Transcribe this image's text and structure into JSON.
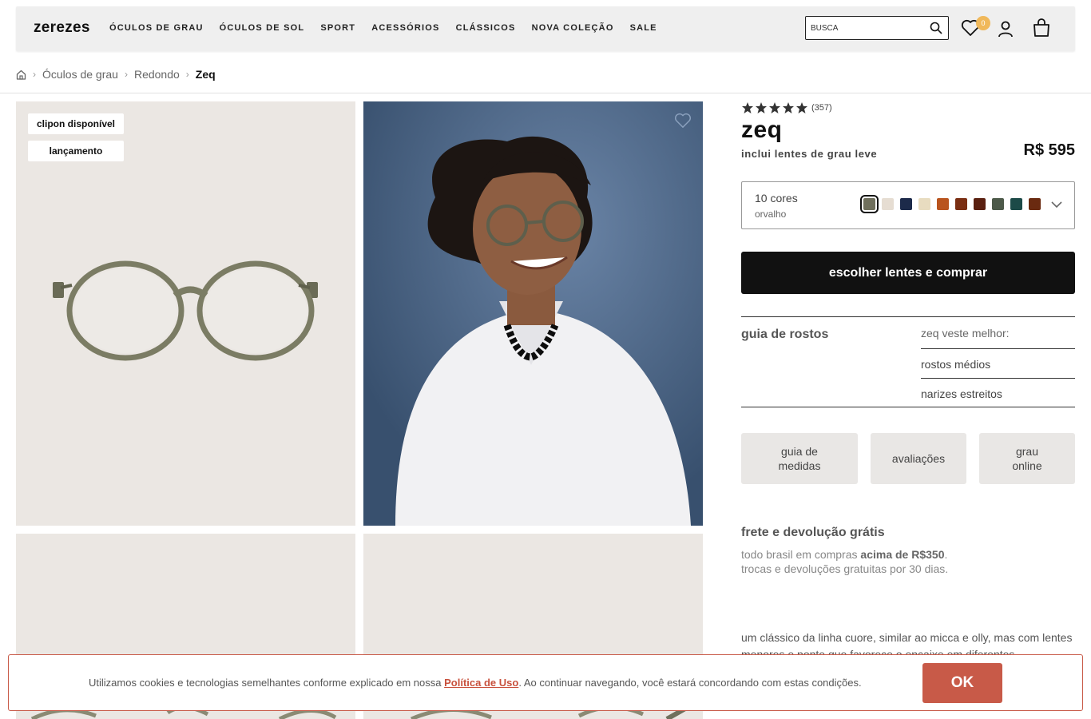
{
  "header": {
    "logo": "zerezes",
    "nav": [
      "ÓCULOS DE GRAU",
      "ÓCULOS DE SOL",
      "SPORT",
      "ACESSÓRIOS",
      "CLÁSSICOS",
      "NOVA COLEÇÃO",
      "SALE"
    ],
    "search_placeholder": "BUSCA",
    "wishlist_count": "0"
  },
  "breadcrumb": {
    "items": [
      "Óculos de grau",
      "Redondo"
    ],
    "current": "Zeq"
  },
  "gallery": {
    "tags": [
      "clipon disponível",
      "lançamento"
    ]
  },
  "product": {
    "rating_stars": 5,
    "rating_count": "(357)",
    "name": "zeq",
    "subtitle": "inclui lentes de grau leve",
    "price": "R$ 595",
    "colors_count": "10 cores",
    "selected_color": "orvalho",
    "swatches": [
      "#6f6f5c",
      "#e6ddd2",
      "#1c2a4a",
      "#e8dcc0",
      "#b9541e",
      "#7a2e12",
      "#5a2010",
      "#4d5a4a",
      "#1c4a48",
      "#6a2a10"
    ],
    "buy_label": "escolher lentes e comprar",
    "faces_title": "guia de rostos",
    "faces_head": "zeq veste melhor:",
    "faces_items": [
      "rostos médios",
      "narizes estreitos"
    ],
    "buttons": {
      "measures": "guia de medidas",
      "reviews": "avaliações",
      "online": "grau online"
    },
    "shipping_title": "frete e devolução grátis",
    "shipping_line1_prefix": "todo brasil em compras ",
    "shipping_line1_bold": "acima de R$350",
    "shipping_line1_suffix": ".",
    "shipping_line2": "trocas e devoluções gratuitas por 30 dias.",
    "description": "um clássico da linha cuore, similar ao micca e olly, mas com lentes menores e ponte que favorece o encaixe em diferentes"
  },
  "cookie": {
    "text_before": "Utilizamos cookies e tecnologias semelhantes conforme explicado em nossa ",
    "link": "Política de Uso",
    "text_after": ". Ao continuar navegando, você estará concordando com estas condições.",
    "ok": "OK"
  }
}
